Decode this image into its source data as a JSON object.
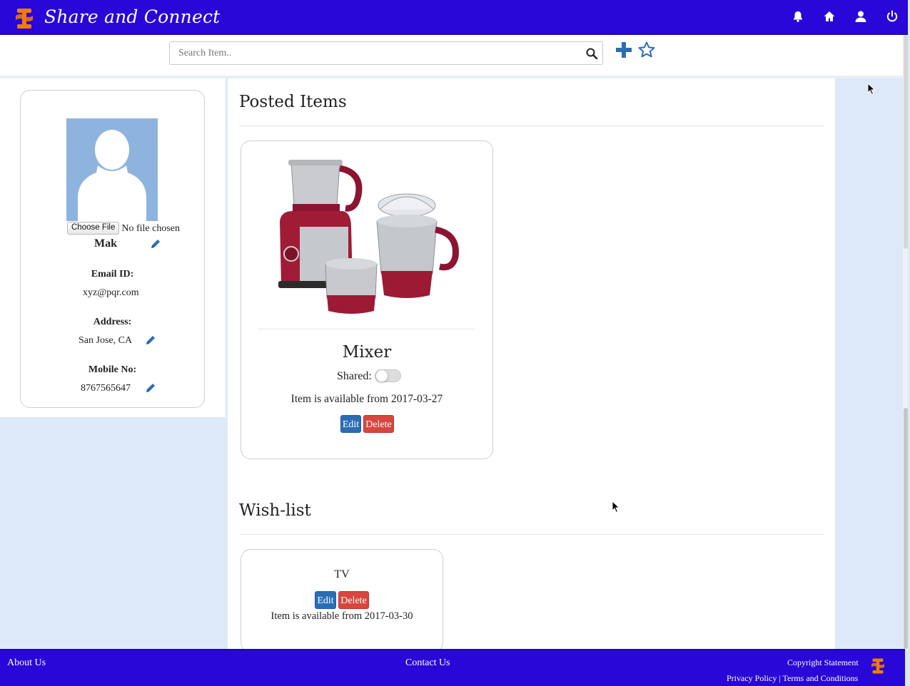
{
  "app": {
    "brand": "Share and Connect",
    "colors": {
      "nav": "#2807d8",
      "accent": "#2a6db5",
      "danger": "#d9463f",
      "logo": "#f57c00"
    }
  },
  "nav": {
    "icons": [
      "bell-icon",
      "home-icon",
      "user-icon",
      "power-icon"
    ]
  },
  "search": {
    "placeholder": "Search Item..",
    "value": ""
  },
  "profile": {
    "file_button": "Choose File",
    "file_status": "No file chosen",
    "name": "Mak",
    "email_label": "Email ID:",
    "email": "xyz@pqr.com",
    "address_label": "Address:",
    "address": "San Jose, CA",
    "mobile_label": "Mobile No:",
    "mobile": "8767565647"
  },
  "posted": {
    "title": "Posted Items",
    "items": [
      {
        "name": "Mixer",
        "shared_label": "Shared:",
        "shared": false,
        "available": "Item is available from 2017-03-27",
        "edit": "Edit",
        "delete": "Delete"
      }
    ]
  },
  "wishlist": {
    "title": "Wish-list",
    "items": [
      {
        "name": "TV",
        "edit": "Edit",
        "delete": "Delete",
        "available": "Item is available from 2017-03-30"
      }
    ]
  },
  "footer": {
    "about": "About Us",
    "contact": "Contact Us",
    "copyright": "Copyright Statement",
    "privacy": "Privacy Policy",
    "separator": "|",
    "terms": "Terms and Conditions"
  }
}
